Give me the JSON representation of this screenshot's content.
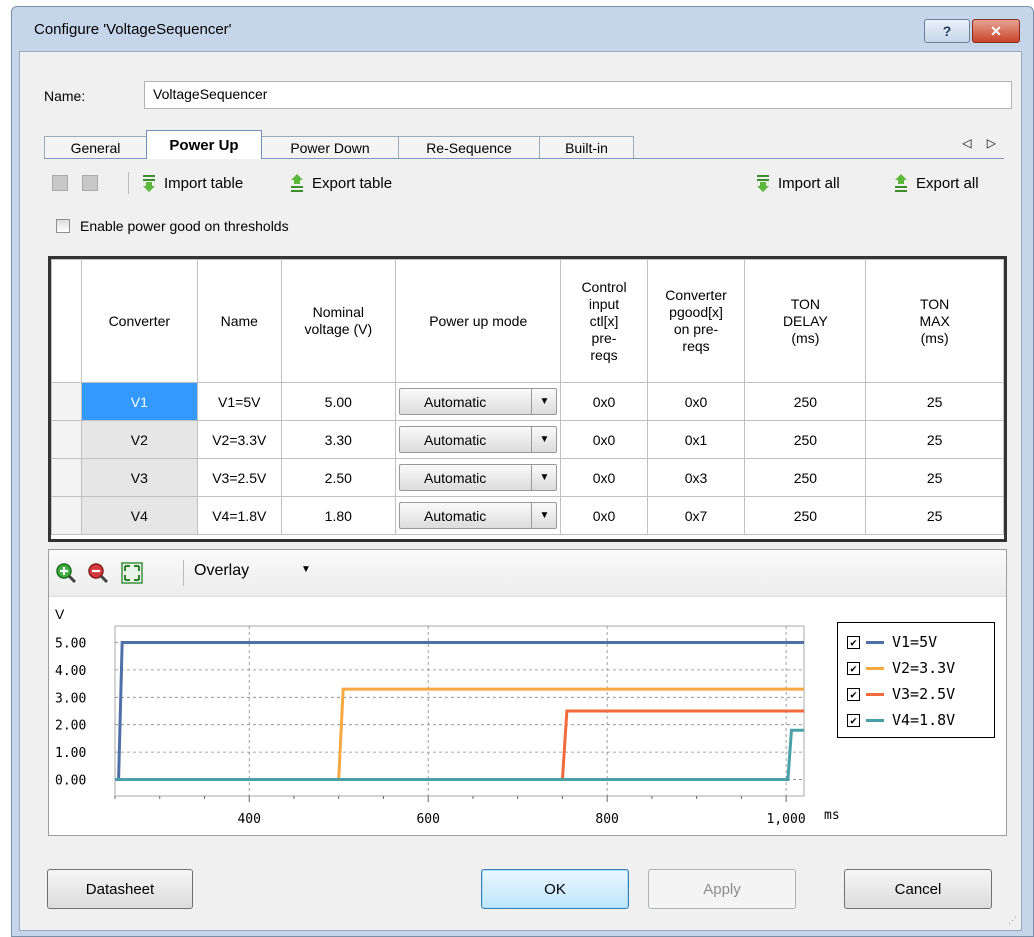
{
  "window": {
    "title": "Configure 'VoltageSequencer'",
    "help_label": "?",
    "close_label": "✕"
  },
  "name_field": {
    "label": "Name:",
    "value": "VoltageSequencer"
  },
  "tabs": [
    {
      "label": "General"
    },
    {
      "label": "Power Up",
      "active": true
    },
    {
      "label": "Power Down"
    },
    {
      "label": "Re-Sequence"
    },
    {
      "label": "Built-in"
    }
  ],
  "tab_nav": "◁ ▷",
  "toolbar": {
    "import_table": "Import table",
    "export_table": "Export table",
    "import_all": "Import all",
    "export_all": "Export all"
  },
  "enable_pg": {
    "label": "Enable power good on thresholds",
    "checked": false
  },
  "table": {
    "headers": [
      "Converter",
      "Name",
      "Nominal voltage (V)",
      "Power up mode",
      "Control input ctl[x] pre-reqs",
      "Converter pgood[x] on pre-reqs",
      "TON DELAY (ms)",
      "TON MAX (ms)"
    ],
    "rows": [
      {
        "converter": "V1",
        "name": "V1=5V",
        "voltage": "5.00",
        "mode": "Automatic",
        "ctl": "0x0",
        "pgood": "0x0",
        "ton_delay": "250",
        "ton_max": "25"
      },
      {
        "converter": "V2",
        "name": "V2=3.3V",
        "voltage": "3.30",
        "mode": "Automatic",
        "ctl": "0x0",
        "pgood": "0x1",
        "ton_delay": "250",
        "ton_max": "25"
      },
      {
        "converter": "V3",
        "name": "V3=2.5V",
        "voltage": "2.50",
        "mode": "Automatic",
        "ctl": "0x0",
        "pgood": "0x3",
        "ton_delay": "250",
        "ton_max": "25"
      },
      {
        "converter": "V4",
        "name": "V4=1.8V",
        "voltage": "1.80",
        "mode": "Automatic",
        "ctl": "0x0",
        "pgood": "0x7",
        "ton_delay": "250",
        "ton_max": "25"
      }
    ]
  },
  "chart_toolbar": {
    "mode": "Overlay"
  },
  "chart_data": {
    "type": "line",
    "ylabel": "V",
    "xlabel": "ms",
    "xlim": [
      250,
      1020
    ],
    "ylim": [
      -0.6,
      5.6
    ],
    "yticks": [
      "0.00",
      "1.00",
      "2.00",
      "3.00",
      "4.00",
      "5.00"
    ],
    "ytick_values": [
      0,
      1,
      2,
      3,
      4,
      5
    ],
    "xticks": [
      "400",
      "600",
      "800",
      "1,000"
    ],
    "xtick_values": [
      400,
      600,
      800,
      1000
    ],
    "grid": true,
    "legend": "right",
    "series": [
      {
        "name": "V1=5V",
        "color": "#4f6fa8",
        "x": [
          250,
          254,
          258,
          1020
        ],
        "y": [
          0,
          0,
          5,
          5
        ]
      },
      {
        "name": "V2=3.3V",
        "color": "#f7a840",
        "x": [
          250,
          500,
          505,
          1020
        ],
        "y": [
          0,
          0,
          3.3,
          3.3
        ]
      },
      {
        "name": "V3=2.5V",
        "color": "#f26a3c",
        "x": [
          250,
          750,
          755,
          1020
        ],
        "y": [
          0,
          0,
          2.5,
          2.5
        ]
      },
      {
        "name": "V4=1.8V",
        "color": "#4aa0a8",
        "x": [
          250,
          1002,
          1006,
          1020
        ],
        "y": [
          0,
          0,
          1.8,
          1.8
        ]
      }
    ]
  },
  "buttons": {
    "datasheet": "Datasheet",
    "ok": "OK",
    "apply": "Apply",
    "cancel": "Cancel"
  }
}
